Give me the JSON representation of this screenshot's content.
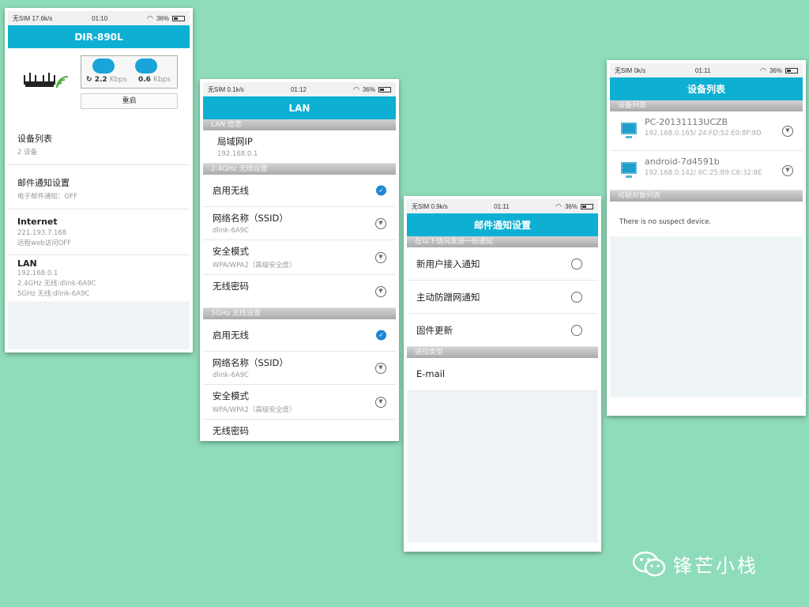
{
  "phone1": {
    "status": {
      "carrier": "无SIM 17.6k/s",
      "time": "01:10",
      "battery": "36%"
    },
    "title": "DIR-890L",
    "download_speed": "2.2",
    "upload_speed": "0.6",
    "speed_unit": "Kbps",
    "reboot_label": "重启",
    "rows": [
      {
        "main": "设备列表",
        "sub": "2 设备"
      },
      {
        "main": "邮件通知设置",
        "sub": "电子邮件通知：OFF"
      },
      {
        "main": "Internet",
        "sub": "221.193.7.168",
        "sub2": "远程web访问OFF"
      },
      {
        "main": "LAN",
        "sub": "192.168.0.1",
        "sub2": "2.4GHz 无线:dlink-6A9C",
        "sub3": "5GHz 无线:dlink-6A9C"
      }
    ]
  },
  "phone2": {
    "status": {
      "carrier": "无SIM 0.1k/s",
      "time": "01:12",
      "battery": "36%"
    },
    "title": "LAN",
    "section_lan": "LAN 信息",
    "lan_ip_label": "局域网IP",
    "lan_ip_value": "192.168.0.1",
    "section_24": "2.4GHz 无线设置",
    "section_5": "5GHz 无线设置",
    "enable_wireless": "启用无线",
    "ssid_label": "网络名称（SSID）",
    "ssid_value": "dlink-6A9C",
    "security_label": "安全模式",
    "security_value": "WPA/WPA2（高级安全度）",
    "password_label": "无线密码"
  },
  "phone3": {
    "status": {
      "carrier": "无SIM 0.9k/s",
      "time": "01:11",
      "battery": "36%"
    },
    "title": "邮件通知设置",
    "section_notify": "在以下情况发送一份通知",
    "options": [
      "新用户接入通知",
      "主动防蹭网通知",
      "固件更新"
    ],
    "section_type": "通知类型",
    "type_value": "E-mail"
  },
  "phone4": {
    "status": {
      "carrier": "无SIM 0k/s",
      "time": "01:11",
      "battery": "36%"
    },
    "title": "设备列表",
    "section_devices": "设备列表",
    "devices": [
      {
        "name": "PC-20131113UCZB",
        "detail": "192.168.0.165/ 24:FD:52:E0:8F:9D"
      },
      {
        "name": "android-7d4591b",
        "detail": "192.168.0.142/ 6C:25:B9:C6:32:8E"
      }
    ],
    "section_suspect": "可疑对象列表",
    "suspect_text": "There is no suspect device."
  },
  "watermark": "锋芒小栈"
}
